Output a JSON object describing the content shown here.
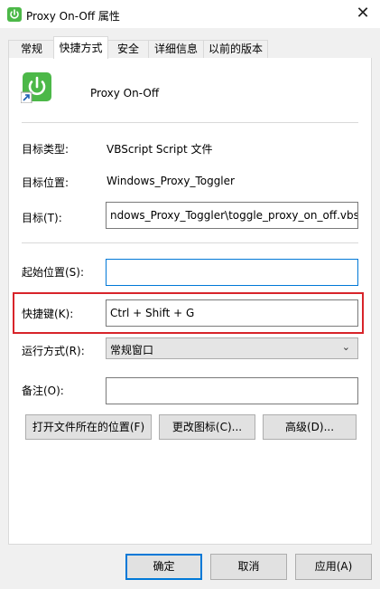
{
  "window": {
    "title": "Proxy On-Off 属性",
    "close_glyph": "✕"
  },
  "tabs": [
    {
      "label": "常规"
    },
    {
      "label": "快捷方式"
    },
    {
      "label": "安全"
    },
    {
      "label": "详细信息"
    },
    {
      "label": "以前的版本"
    }
  ],
  "shortcut": {
    "name": "Proxy On-Off",
    "icon": "power-toggle-icon",
    "target_type_label": "目标类型:",
    "target_type_value": "VBScript Script 文件",
    "target_location_label": "目标位置:",
    "target_location_value": "Windows_Proxy_Toggler",
    "target_label": "目标(T):",
    "target_value": "ndows_Proxy_Toggler\\toggle_proxy_on_off.vbs",
    "start_in_label": "起始位置(S):",
    "start_in_value": "",
    "hotkey_label": "快捷键(K):",
    "hotkey_value": "Ctrl + Shift + G",
    "run_label": "运行方式(R):",
    "run_value": "常规窗口",
    "comment_label": "备注(O):",
    "comment_value": "",
    "open_location_button": "打开文件所在的位置(F)",
    "change_icon_button": "更改图标(C)...",
    "advanced_button": "高级(D)..."
  },
  "footer": {
    "ok": "确定",
    "cancel": "取消",
    "apply": "应用(A)"
  },
  "colors": {
    "highlight": "#d8242a",
    "focus": "#0078d7",
    "icon_green": "#4cb848"
  }
}
